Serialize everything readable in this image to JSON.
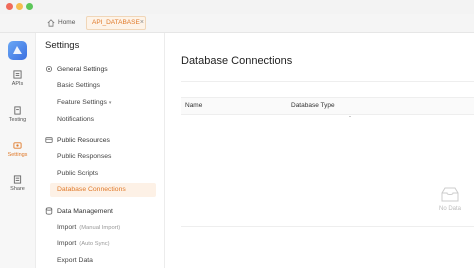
{
  "window": {
    "dots": [
      "#f06a5a",
      "#f5bd4f",
      "#5cc65a"
    ]
  },
  "tabs": {
    "home": "Home",
    "active": "API_DATABASE",
    "close": "×"
  },
  "rail": [
    {
      "label": "APIs",
      "icon": "api-icon"
    },
    {
      "label": "Testing",
      "icon": "testing-icon"
    },
    {
      "label": "Settings",
      "icon": "settings-icon",
      "active": true
    },
    {
      "label": "Share",
      "icon": "share-icon"
    }
  ],
  "settings": {
    "title": "Settings",
    "general": {
      "heading": "General Settings",
      "items": [
        "Basic Settings",
        "Feature Settings",
        "Notifications"
      ]
    },
    "resources": {
      "heading": "Public Resources",
      "items": [
        "Public Responses",
        "Public Scripts",
        "Database Connections"
      ]
    },
    "data": {
      "heading": "Data Management",
      "items": [
        {
          "label": "Import",
          "hint": "(Manual Import)"
        },
        {
          "label": "Import",
          "hint": "(Auto Sync)"
        },
        {
          "label": "Export Data",
          "hint": ""
        }
      ]
    }
  },
  "content": {
    "title": "Database Connections",
    "columns": [
      "Name",
      "Database Type"
    ],
    "dash": "-",
    "empty_text": "No Data"
  },
  "colors": {
    "accent": "#e07a2a",
    "accent_bg": "#fdf1e6"
  }
}
